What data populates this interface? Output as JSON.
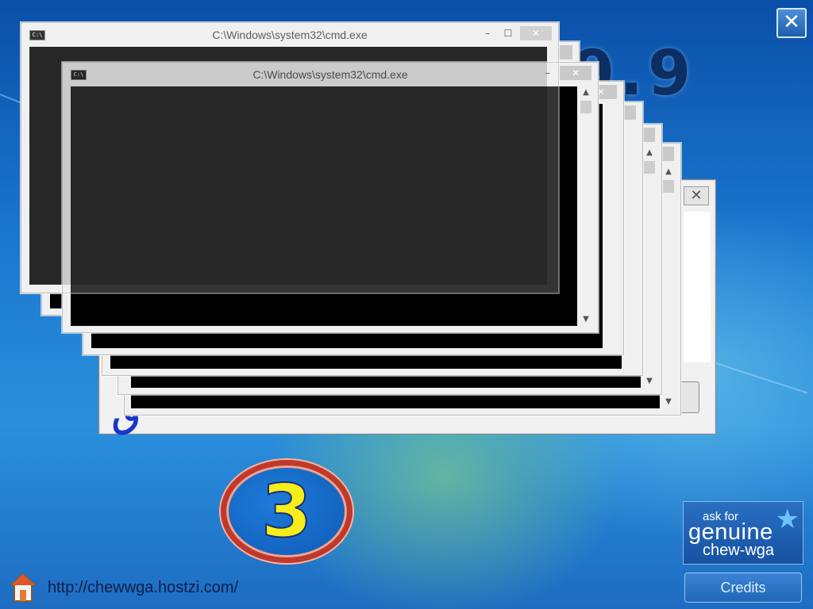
{
  "app": {
    "version_banner": "9.9",
    "close_glyph": "✕"
  },
  "cmd_windows": {
    "title": "C:\\Windows\\system32\\cmd.exe",
    "icon_label": "C:\\",
    "minimize_glyph": "–",
    "maximize_glyph": "☐",
    "close_glyph": "✕"
  },
  "dialog": {
    "close_glyph": "✕",
    "logo_glyph": "ق"
  },
  "badge": {
    "countdown": "3"
  },
  "footer": {
    "url": "http://chewwga.hostzi.com/",
    "home_icon": "home-icon"
  },
  "genuine": {
    "line1": "ask for",
    "line2": "genuine",
    "line3": "chew-wga",
    "star_icon": "star-icon"
  },
  "credits": {
    "label": "Credits"
  },
  "colors": {
    "desktop_blue": "#1b78cf",
    "badge_ring": "#c0392b",
    "badge_number": "#f5ee1a"
  }
}
